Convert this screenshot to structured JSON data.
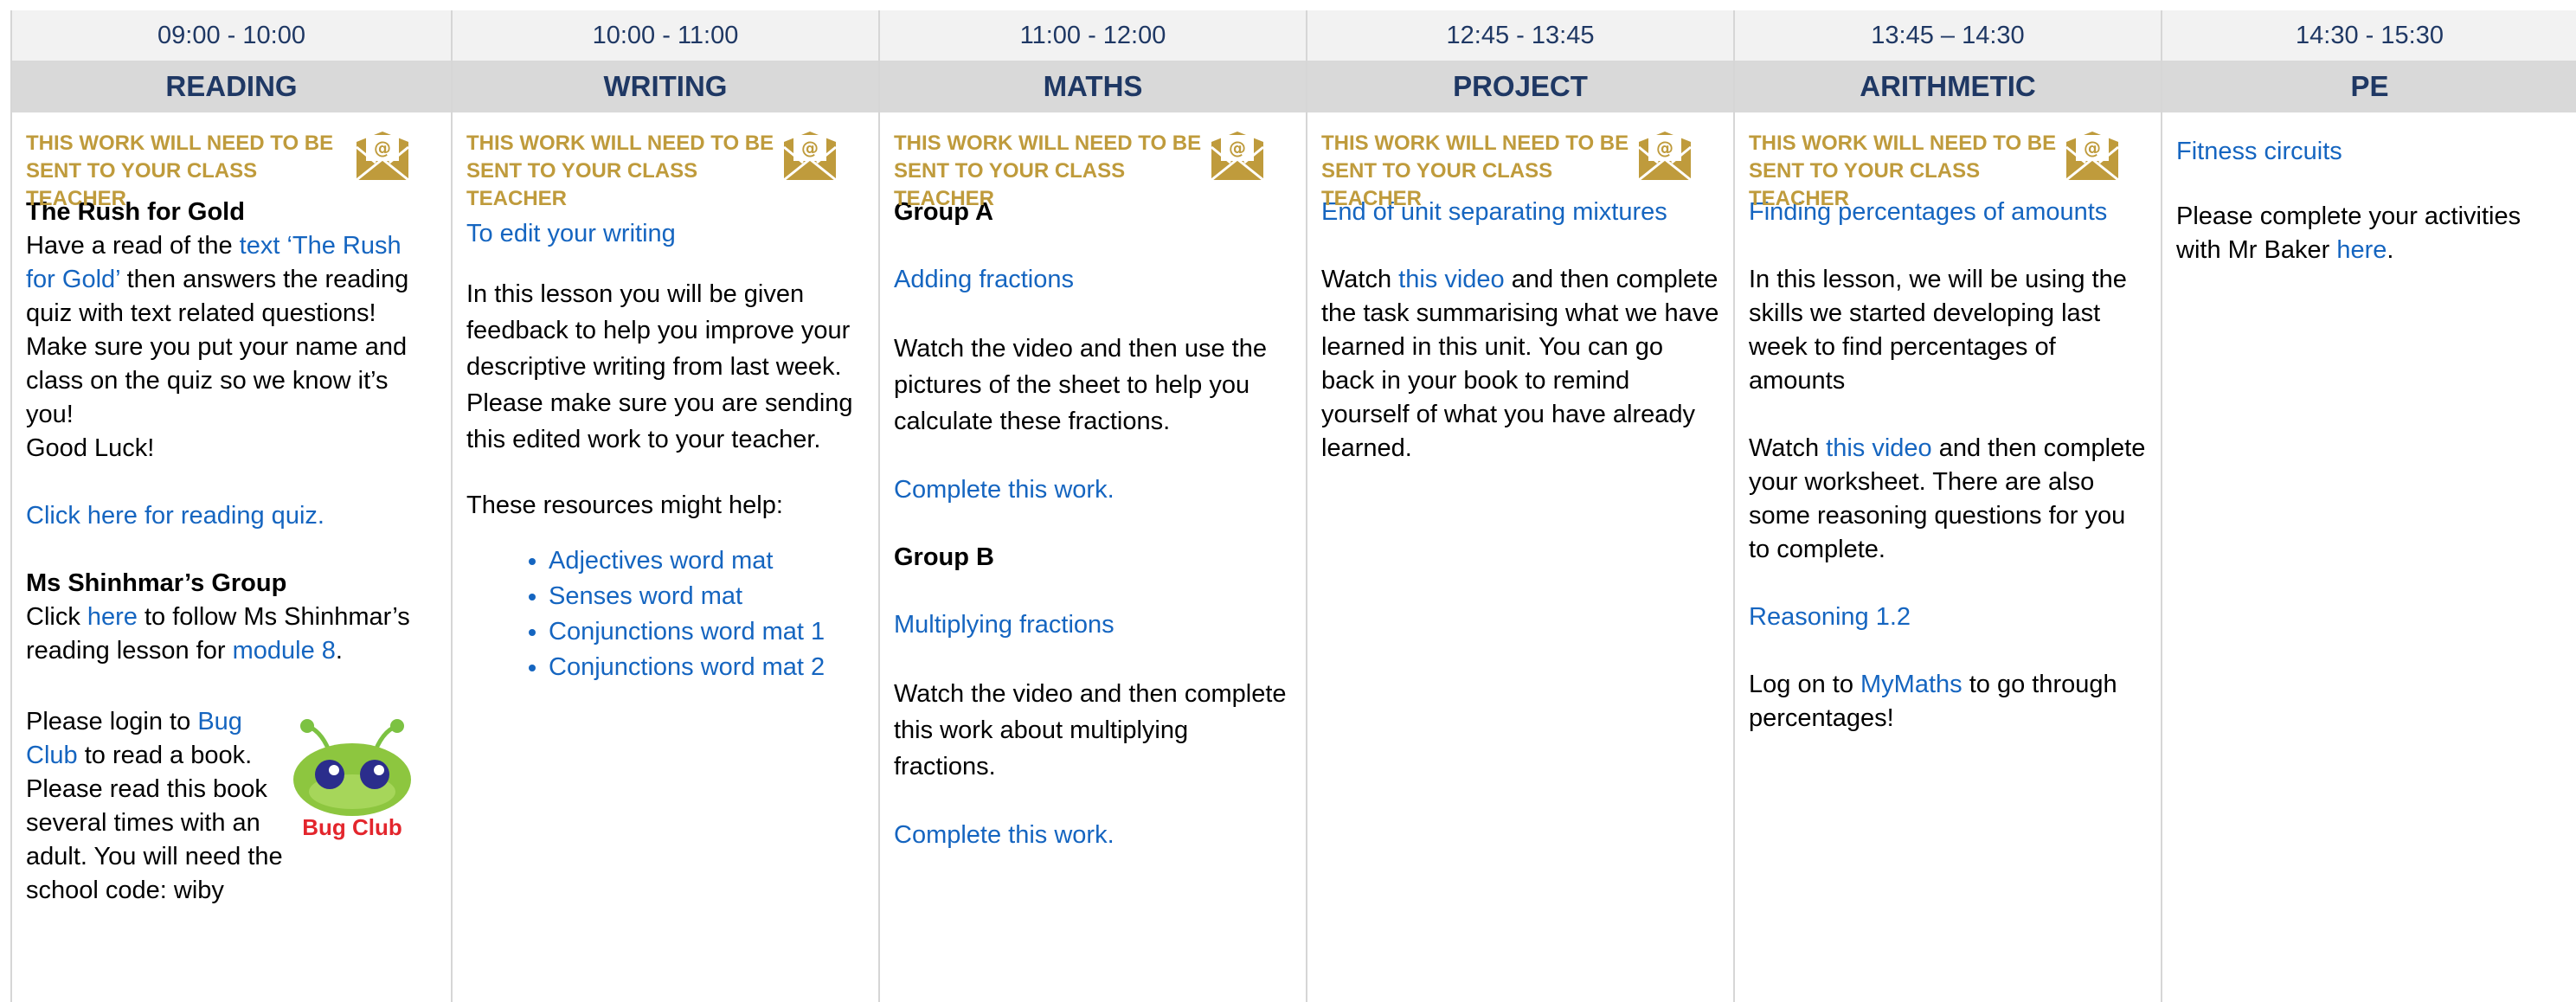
{
  "times": [
    "09:00 - 10:00",
    "10:00 - 11:00",
    "11:00 - 12:00",
    "12:45 - 13:45",
    "13:45 – 14:30",
    "14:30 - 15:30"
  ],
  "subjects": [
    "READING",
    "WRITING",
    "MATHS",
    "PROJECT",
    "ARITHMETIC",
    "PE"
  ],
  "notice": "THIS WORK WILL NEED TO BE SENT TO YOUR CLASS TEACHER",
  "icons": {
    "mail": "envelope-at-icon",
    "bug_club": "bug-club-logo"
  },
  "colors": {
    "header_text": "#1f3864",
    "notice": "#bf9b3c",
    "link": "#1565c0",
    "time_bg": "#f2f2f2",
    "subject_bg": "#d9d9d9"
  },
  "reading": {
    "title": "The Rush for Gold",
    "p1_before": "Have a read of the ",
    "p1_link": "text ‘The Rush for Gold’",
    "p1_after": " then answers the reading quiz with text related questions! Make sure you put your name and class on the quiz so we know it’s you!",
    "p1_end": "Good Luck!",
    "quiz_link": "Click here for reading quiz.",
    "group_title": "Ms Shinhmar’s Group",
    "group_p_before": "Click ",
    "group_p_link": "here",
    "group_p_mid": " to follow Ms Shinhmar’s reading lesson for ",
    "group_p_link2": "module 8",
    "group_p_after": ".",
    "bug_before": "Please login to ",
    "bug_link": "Bug Club",
    "bug_after": " to read a book. Please read this book several times with an adult. You will need the school code: wiby",
    "bug_logo_text": "Bug Club"
  },
  "writing": {
    "link": "To edit your writing",
    "p1": "In this lesson you will be given feedback to help you improve your descriptive writing from last week. Please make sure you are sending this edited work to your teacher.",
    "p2": "These resources might help:",
    "resources": [
      "Adjectives word mat",
      "Senses word mat",
      "Conjunctions word mat 1",
      "Conjunctions word mat 2"
    ]
  },
  "maths": {
    "group_a": "Group A",
    "a_link": "Adding fractions",
    "a_p": "Watch the video and then use the pictures of the sheet to help you calculate these fractions.",
    "a_complete": "Complete this work.",
    "group_b": "Group B",
    "b_link": "Multiplying fractions",
    "b_p": "Watch the video and then complete this work about multiplying fractions.",
    "b_complete": "Complete this work."
  },
  "project": {
    "link": "End of unit separating mixtures",
    "p_before": "Watch ",
    "p_link": "this video",
    "p_after": " and then complete the task summarising what we have learned in this unit. You can go back in your book to remind yourself of what you have already learned."
  },
  "arithmetic": {
    "link": "Finding percentages of amounts",
    "p1": "In this lesson, we will be using the skills we started developing last week to find percentages of amounts",
    "p2_before": "Watch ",
    "p2_link": "this video",
    "p2_after": " and then complete your worksheet. There are also some reasoning questions for you to complete.",
    "reasoning_link": "Reasoning 1.2",
    "p3_before": "Log on to ",
    "p3_link": "MyMaths",
    "p3_after": " to go through percentages!"
  },
  "pe": {
    "link": "Fitness circuits",
    "p_before": "Please complete your activities with Mr Baker ",
    "p_link": "here",
    "p_after": "."
  }
}
